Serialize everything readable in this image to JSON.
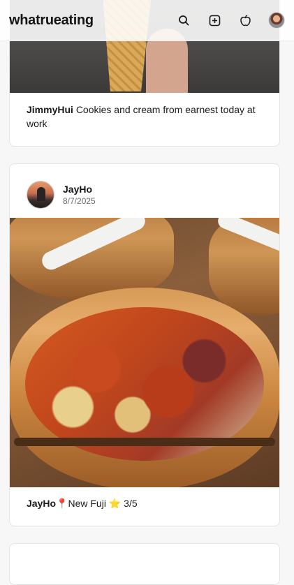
{
  "header": {
    "brand": "whatrueating",
    "icons": [
      "search-icon",
      "add-square-icon",
      "apple-icon",
      "profile-avatar"
    ]
  },
  "posts": [
    {
      "username": "JimmyHui",
      "caption": "Cookies and cream from earnest today at work"
    },
    {
      "username": "JayHo",
      "date": "8/7/2025",
      "caption_user": "JayHo",
      "pin_icon": "📍",
      "place": "New Fuji",
      "star_icon": "⭐",
      "rating": "3/5"
    }
  ],
  "colors": {
    "background": "#f7f7f8",
    "card": "#ffffff",
    "border": "#e4e4e7",
    "text": "#16161a",
    "muted": "#6b6b73"
  }
}
